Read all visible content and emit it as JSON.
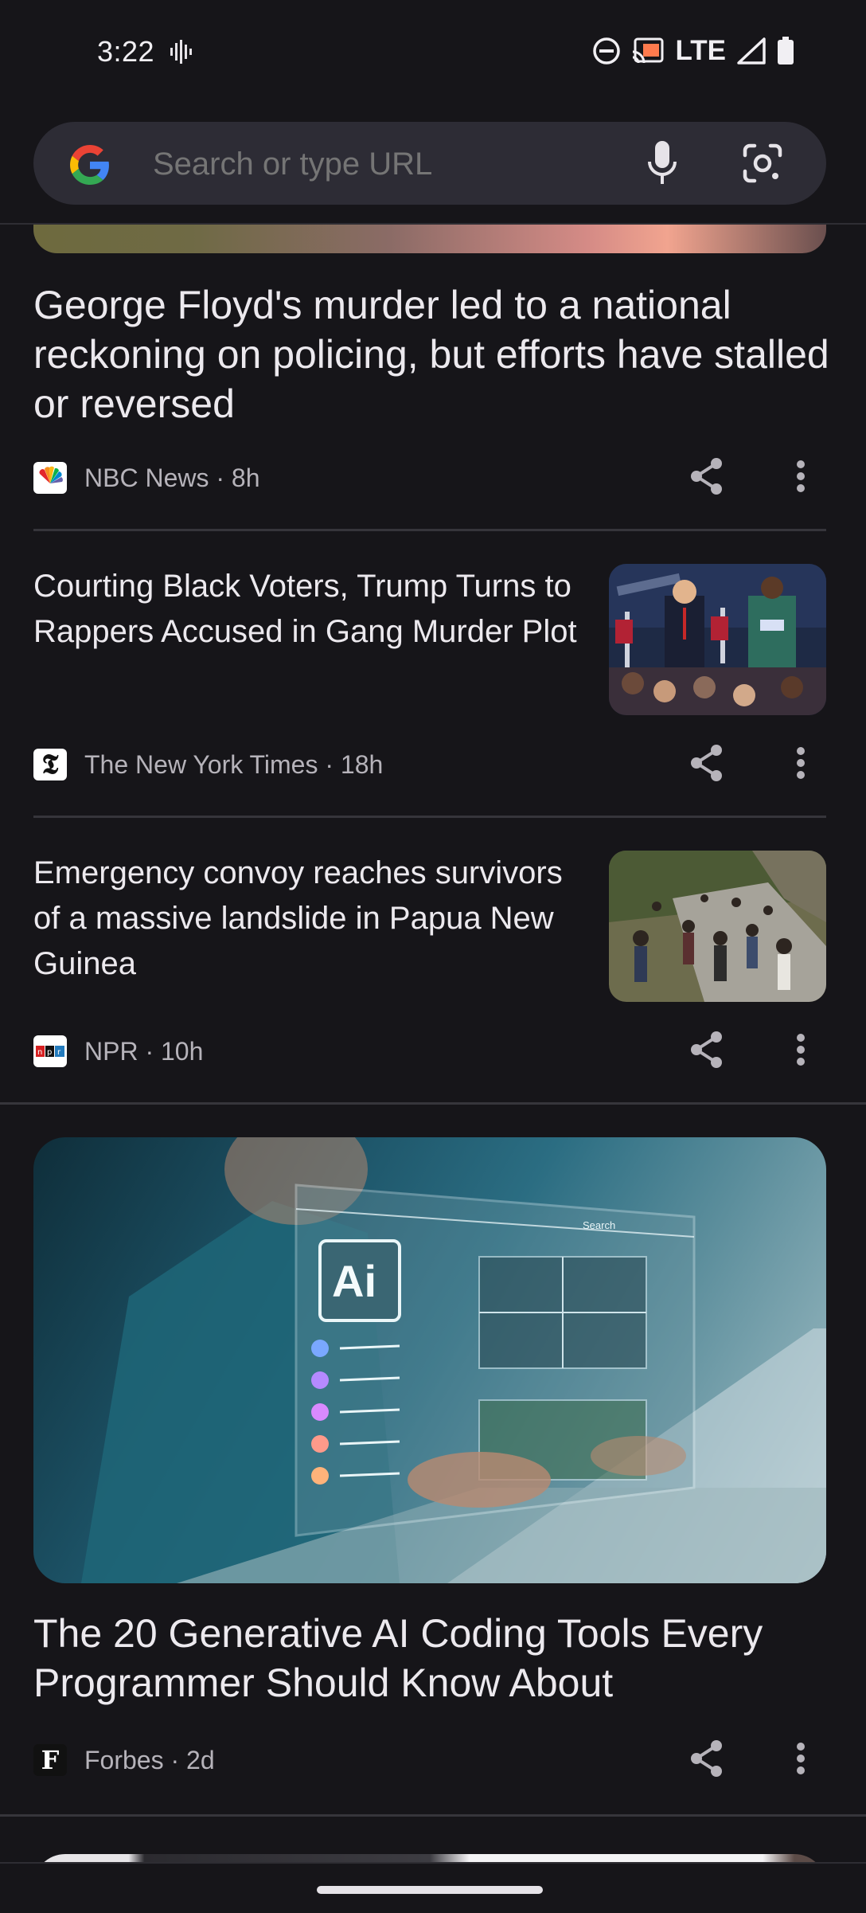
{
  "status_bar": {
    "time": "3:22",
    "network": "LTE"
  },
  "search": {
    "placeholder": "Search or type URL"
  },
  "articles": [
    {
      "title": "George Floyd's murder led to a national reckoning on policing, but efforts have stalled or reversed",
      "source": "NBC News · 8h"
    },
    {
      "title": "Courting Black Voters, Trump Turns to Rappers Accused in Gang Murder Plot",
      "source": "The New York Times · 18h"
    },
    {
      "title": "Emergency convoy reaches survivors of a massive landslide in Papua New Guinea",
      "source": "NPR · 10h"
    },
    {
      "title": "The 20 Generative AI Coding Tools Every Programmer Should Know About",
      "source": "Forbes · 2d"
    }
  ],
  "hero_overlay_text": {
    "ai_chip": "Ai",
    "screen_search": "Search"
  },
  "icons": [
    "vibrate-icon",
    "dnd-icon",
    "cast-icon",
    "signal-icon",
    "battery-icon",
    "google-logo-icon",
    "mic-icon",
    "lens-icon",
    "share-icon",
    "more-vert-icon"
  ]
}
